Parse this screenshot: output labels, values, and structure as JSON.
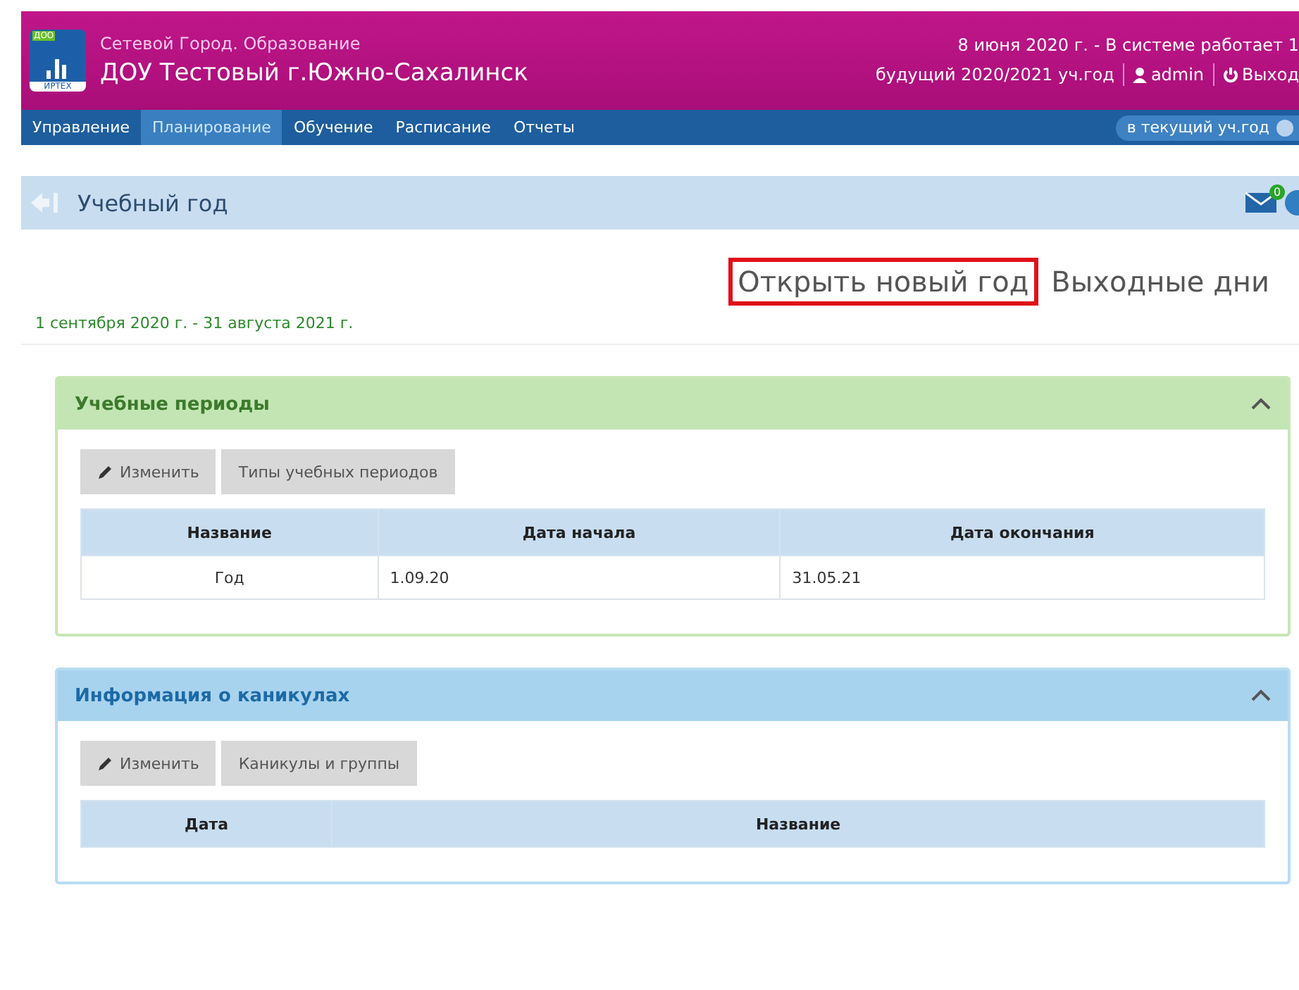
{
  "header": {
    "system_name": "Сетевой Город. Образование",
    "org_name": "ДОУ Тестовый г.Южно-Сахалинск",
    "logo_badge": "ДОО",
    "logo_caption": "ИРТЕХ",
    "status": "8 июня 2020 г. - В системе работает 1",
    "year_link": "будущий 2020/2021 уч.год",
    "user": "admin",
    "logout": "Выход"
  },
  "nav": {
    "items": [
      {
        "label": "Управление",
        "selected": false
      },
      {
        "label": "Планирование",
        "selected": true
      },
      {
        "label": "Обучение",
        "selected": false
      },
      {
        "label": "Расписание",
        "selected": false
      },
      {
        "label": "Отчеты",
        "selected": false
      }
    ],
    "toggle": {
      "label": "в текущий уч.год",
      "on": false
    }
  },
  "page": {
    "title": "Учебный год",
    "mail_badge": "0"
  },
  "actions": [
    {
      "label": "Открыть новый год",
      "highlighted": true
    },
    {
      "label": "Выходные дни",
      "highlighted": false
    }
  ],
  "period": "1 сентября 2020 г. - 31 августа 2021 г.",
  "panels": [
    {
      "title": "Учебные периоды",
      "kind": "green",
      "expanded": true,
      "buttons": [
        {
          "label": "Изменить",
          "kind": "edit"
        },
        {
          "label": "Типы учебных периодов",
          "kind": "plain"
        }
      ],
      "columns": [
        "Название",
        "Дата начала",
        "Дата окончания"
      ],
      "rows": [
        [
          "Год",
          "1.09.20",
          "31.05.21"
        ]
      ]
    },
    {
      "title": "Информация о каникулах",
      "kind": "blue",
      "expanded": true,
      "buttons": [
        {
          "label": "Изменить",
          "kind": "edit"
        },
        {
          "label": "Каникулы и группы",
          "kind": "plain"
        }
      ],
      "columns": [
        "Дата",
        "Название"
      ]
    }
  ]
}
